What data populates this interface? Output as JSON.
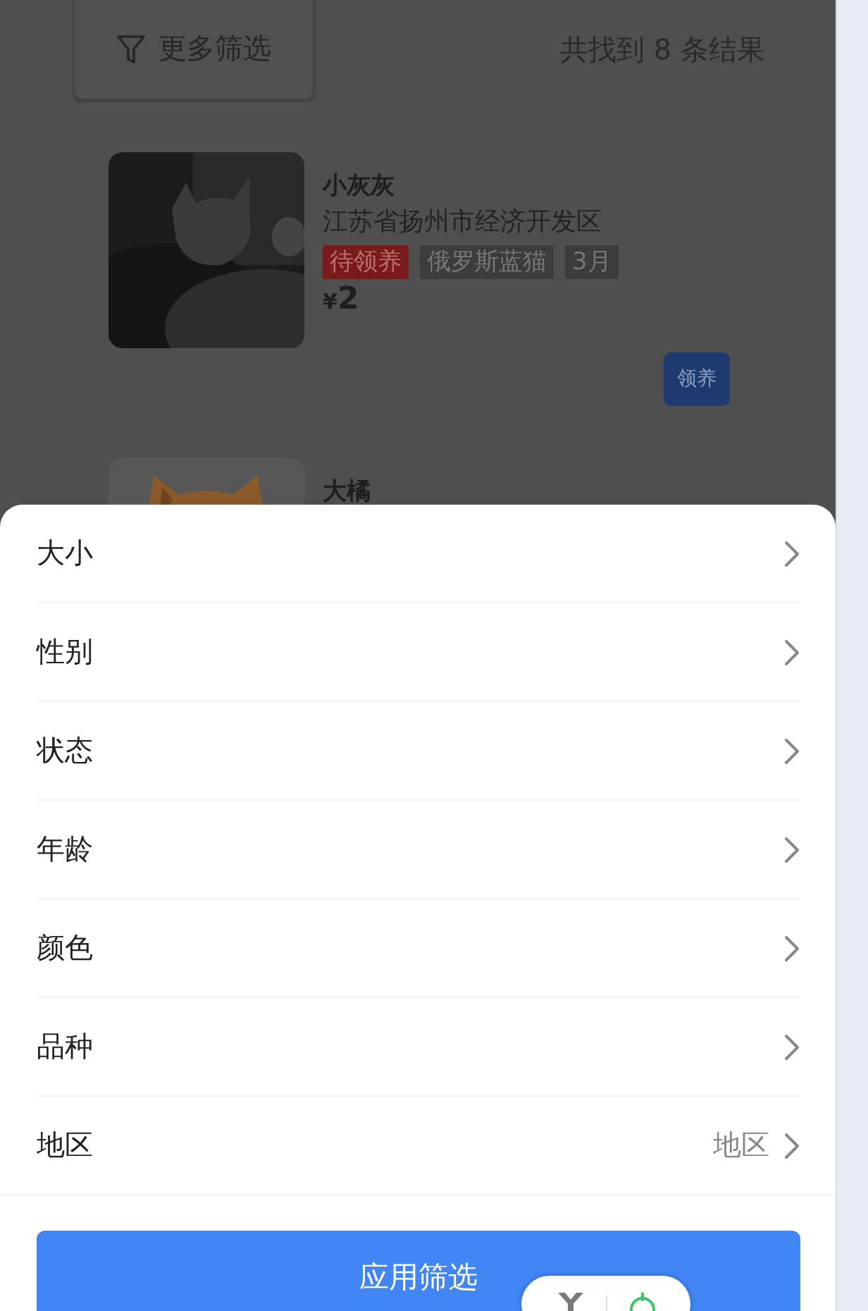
{
  "toolbar": {
    "filter_button": "更多筛选",
    "result_count": "共找到 8 条结果"
  },
  "pets": [
    {
      "name": "小灰灰",
      "location": "江苏省扬州市经济开发区",
      "tags": [
        {
          "label": "待领养",
          "kind": "status"
        },
        {
          "label": "俄罗斯蓝猫",
          "kind": "info"
        },
        {
          "label": "3月",
          "kind": "info"
        }
      ],
      "currency": "¥",
      "price": "2",
      "action": "领养"
    },
    {
      "name": "大橘"
    }
  ],
  "filter_sheet": {
    "options": [
      {
        "label": "大小"
      },
      {
        "label": "性别"
      },
      {
        "label": "状态"
      },
      {
        "label": "年龄"
      },
      {
        "label": "颜色"
      },
      {
        "label": "品种"
      },
      {
        "label": "地区",
        "value": "地区"
      }
    ],
    "apply_button": "应用筛选"
  }
}
